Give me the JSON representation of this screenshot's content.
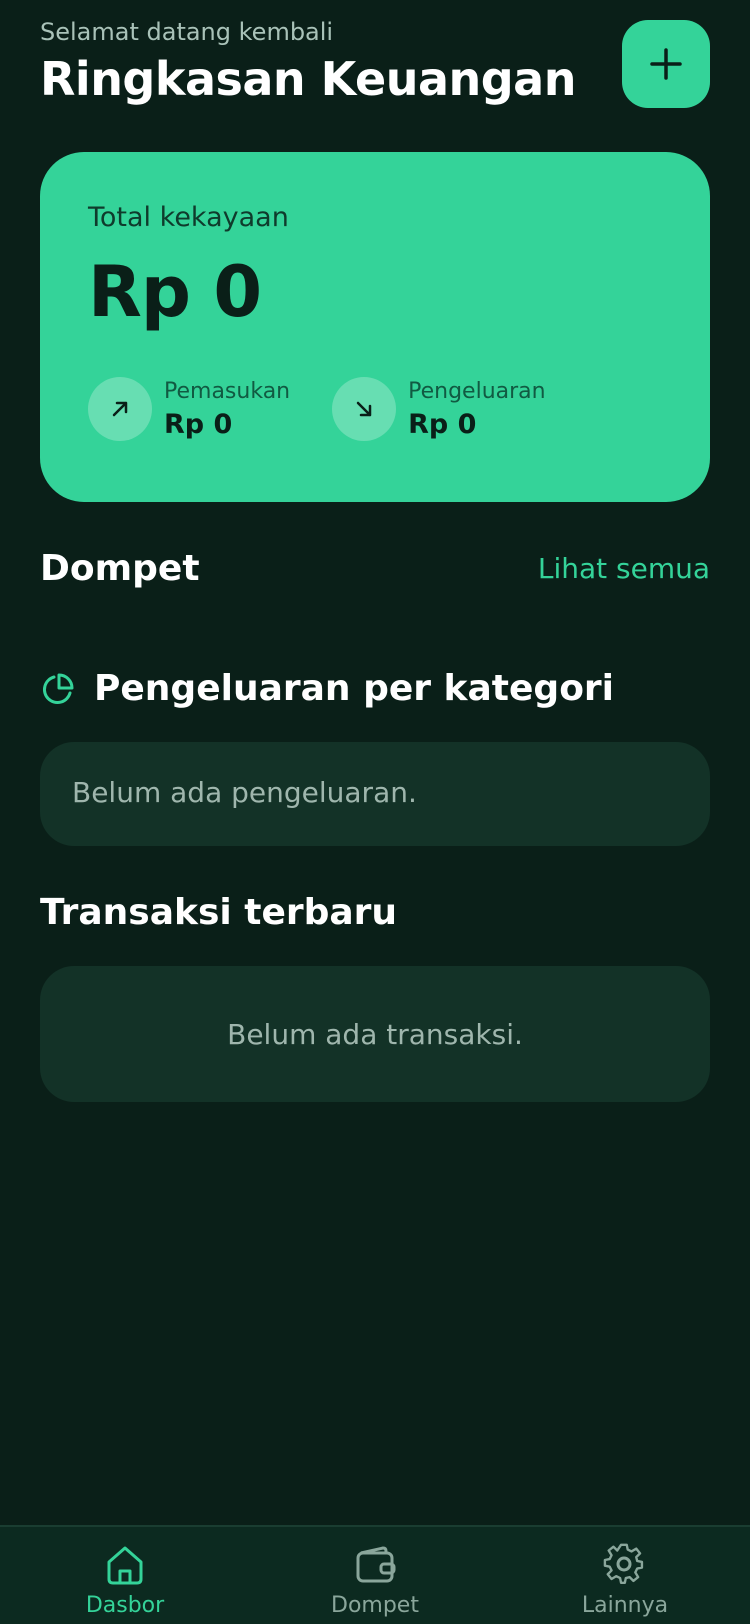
{
  "header": {
    "greeting": "Selamat datang kembali",
    "title": "Ringkasan Keuangan",
    "add_icon": "plus-icon"
  },
  "summary": {
    "label": "Total kekayaan",
    "amount": "Rp 0",
    "income": {
      "label": "Pemasukan",
      "value": "Rp 0",
      "icon": "arrow-up-right-icon"
    },
    "expense": {
      "label": "Pengeluaran",
      "value": "Rp 0",
      "icon": "arrow-down-right-icon"
    }
  },
  "wallet_section": {
    "title": "Dompet",
    "link": "Lihat semua"
  },
  "category_section": {
    "title": "Pengeluaran per kategori",
    "icon": "pie-chart-icon",
    "empty": "Belum ada pengeluaran."
  },
  "transactions_section": {
    "title": "Transaksi terbaru",
    "empty": "Belum ada transaksi."
  },
  "nav": {
    "items": [
      {
        "label": "Dasbor",
        "icon": "home-icon",
        "active": true
      },
      {
        "label": "Dompet",
        "icon": "wallet-icon",
        "active": false
      },
      {
        "label": "Lainnya",
        "icon": "gear-icon",
        "active": false
      }
    ]
  },
  "colors": {
    "accent": "#34d399",
    "background": "#0a1f18",
    "card": "#133227"
  }
}
